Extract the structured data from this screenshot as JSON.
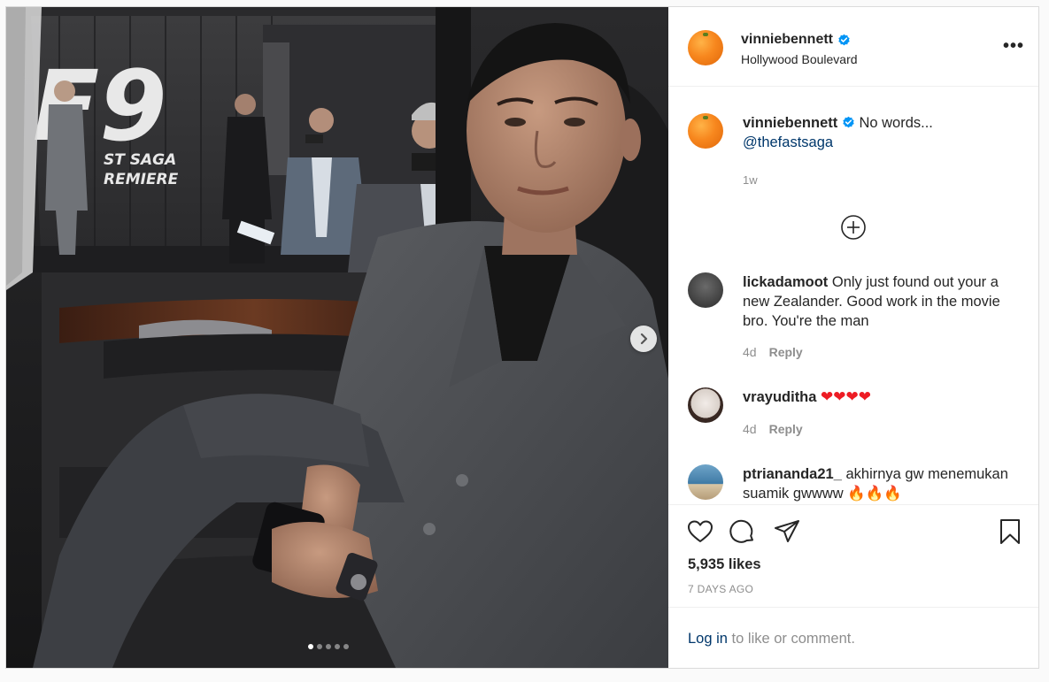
{
  "post": {
    "author": {
      "username": "vinniebennett",
      "verified": true,
      "location": "Hollywood Boulevard"
    },
    "caption": {
      "username": "vinniebennett",
      "text": "No words...",
      "mention": "@thefastsaga",
      "time": "1w"
    },
    "media": {
      "backdrop_text_1": "F9",
      "backdrop_text_2": "ST SAGA",
      "backdrop_text_3": "REMIERE",
      "carousel_count": 5,
      "carousel_active": 0
    },
    "comments": [
      {
        "username": "lickadamoot",
        "text": "Only just found out your a new Zealander. Good work in the movie bro. You're the man",
        "time": "4d",
        "reply": "Reply"
      },
      {
        "username": "vrayuditha",
        "text": "❤❤❤❤",
        "time": "4d",
        "reply": "Reply"
      },
      {
        "username": "ptriananda21_",
        "text": "akhirnya gw menemukan suamik gwwww 🔥🔥🔥",
        "time": "",
        "reply": ""
      }
    ],
    "likes": "5,935 likes",
    "date": "7 DAYS AGO",
    "login": {
      "link": "Log in",
      "rest": " to like or comment."
    }
  },
  "colors": {
    "link": "#00376b",
    "verified": "#0095f6",
    "muted": "#8e8e8e",
    "heart": "#ed1c24"
  },
  "icons": {
    "verified": "verified-badge-icon",
    "more": "more-options-icon",
    "add_comments": "plus-circle-icon",
    "like": "heart-icon",
    "comment": "comment-bubble-icon",
    "share": "paper-plane-icon",
    "save": "bookmark-icon",
    "next": "chevron-right-icon"
  }
}
